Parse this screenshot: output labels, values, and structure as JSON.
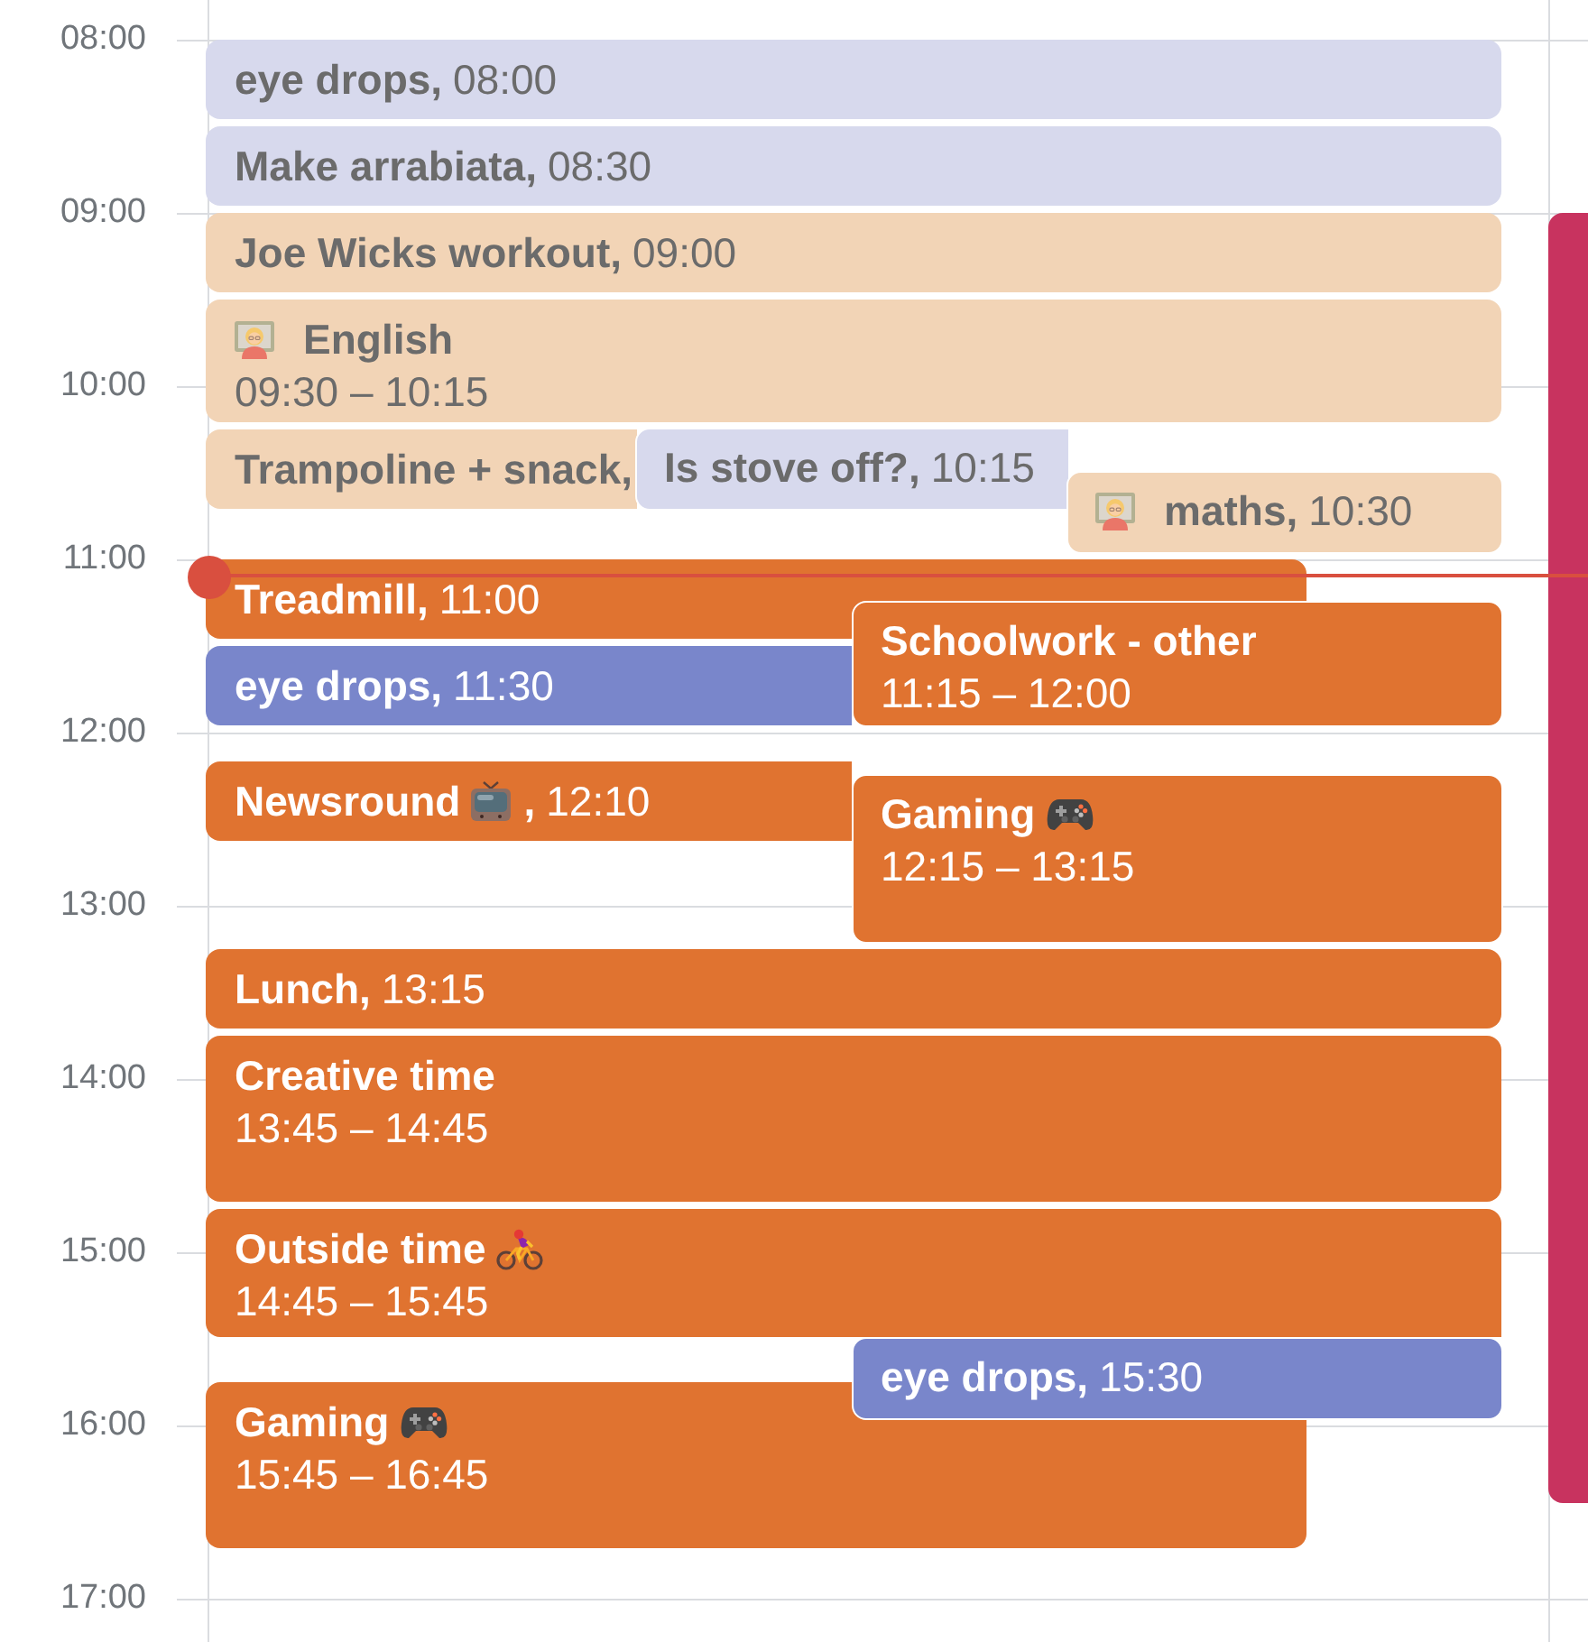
{
  "time_labels": [
    "08:00",
    "09:00",
    "10:00",
    "11:00",
    "12:00",
    "13:00",
    "14:00",
    "15:00",
    "16:00",
    "17:00"
  ],
  "events": [
    {
      "kind": "single_line",
      "title": "eye drops,",
      "time": "08:00",
      "color": "#d7d9ed"
    },
    {
      "kind": "single_line",
      "title": "Make arrabiata,",
      "time": "08:30",
      "color": "#d7d9ed"
    },
    {
      "kind": "single_line",
      "title": "Joe Wicks workout,",
      "time": "09:00",
      "color": "#f2d4b6"
    },
    {
      "kind": "two_line",
      "title": "English",
      "time_range": "09:30 – 10:15",
      "color": "#f2d4b6"
    },
    {
      "kind": "single_line",
      "title": "Trampoline + snack,",
      "color": "#f2d4b6"
    },
    {
      "kind": "single_line",
      "title": "Is stove off?,",
      "time": "10:15",
      "color": "#d7d9ed"
    },
    {
      "kind": "single_line",
      "title": "maths,",
      "time": "10:30",
      "color": "#f2d4b6"
    },
    {
      "kind": "single_line",
      "title": "Treadmill,",
      "time": "11:00",
      "color": "#e07330"
    },
    {
      "kind": "single_line",
      "title": "eye drops,",
      "time": "11:30",
      "color": "#7986cb"
    },
    {
      "kind": "two_line",
      "title": "Schoolwork - other",
      "time_range": "11:15 – 12:00",
      "color": "#e07330"
    },
    {
      "kind": "single_line",
      "title": "Newsround",
      "title_suffix": ",",
      "time": "12:10",
      "color": "#e07330"
    },
    {
      "kind": "two_line",
      "title": "Gaming",
      "time_range": "12:15 – 13:15",
      "color": "#e07330"
    },
    {
      "kind": "single_line",
      "title": "Lunch,",
      "time": "13:15",
      "color": "#e07330"
    },
    {
      "kind": "two_line",
      "title": "Creative time",
      "time_range": "13:45 – 14:45",
      "color": "#e07330"
    },
    {
      "kind": "two_line",
      "title": "Outside time",
      "time_range": "14:45 – 15:45",
      "color": "#e07330"
    },
    {
      "kind": "single_line",
      "title": "eye drops,",
      "time": "15:30",
      "color": "#7986cb"
    },
    {
      "kind": "two_line",
      "title": "Gaming",
      "time_range": "15:45 – 16:45",
      "color": "#e07330"
    }
  ],
  "other_column_events": [
    {
      "color": "#c8335f"
    }
  ]
}
